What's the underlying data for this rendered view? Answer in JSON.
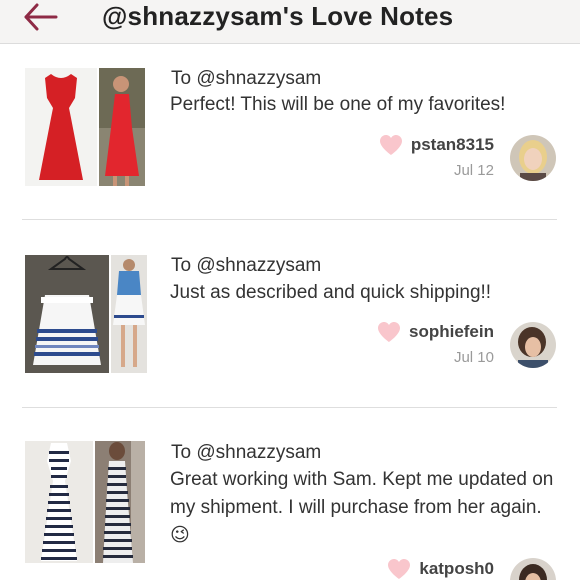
{
  "header": {
    "title": "@shnazzysam's Love Notes"
  },
  "notes": [
    {
      "to": "To @shnazzysam",
      "message": "Perfect! This will be one of my favorites!",
      "username": "pstan8315",
      "date": "Jul 12"
    },
    {
      "to": "To @shnazzysam",
      "message": "Just as described and quick shipping!!",
      "username": "sophiefein",
      "date": "Jul 10"
    },
    {
      "to": "To @shnazzysam",
      "message": "Great working with Sam. Kept me updated on my shipment. I will purchase from her again.",
      "emoji": "😉",
      "username": "katposh0",
      "date": ""
    }
  ],
  "colors": {
    "accent": "#8e2a45",
    "heart": "#f9c6cc",
    "divider": "#dedede",
    "date": "#9a9a9a"
  }
}
